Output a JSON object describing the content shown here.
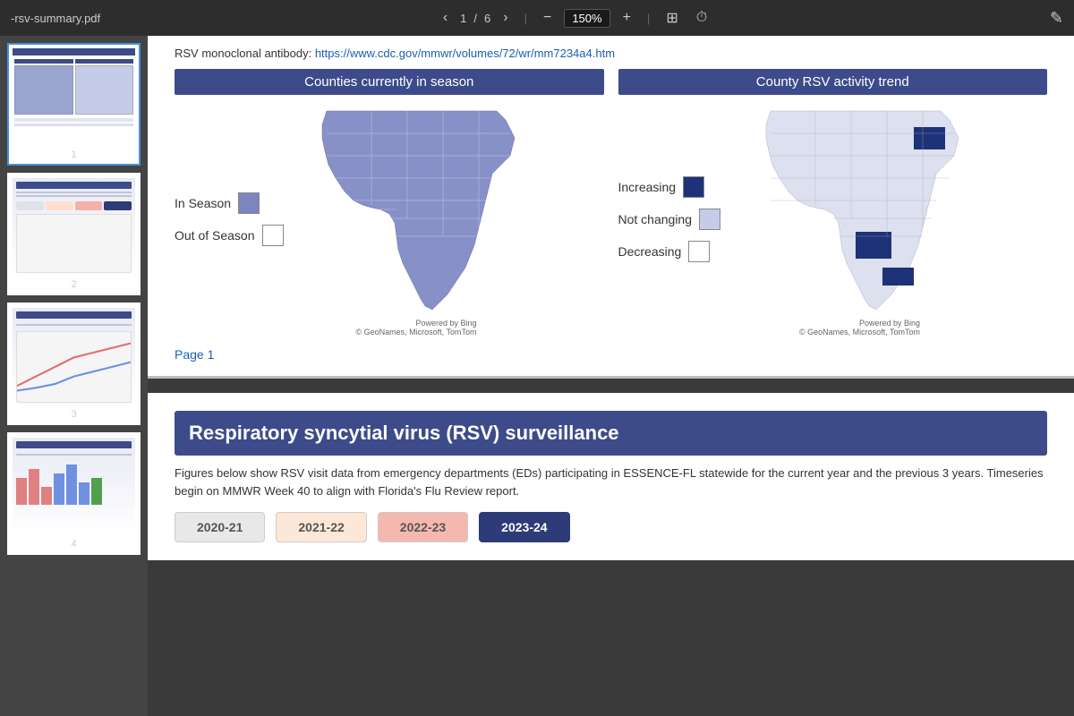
{
  "toolbar": {
    "filename": "-rsv-summary.pdf",
    "page_current": "1",
    "page_total": "6",
    "separator": "/",
    "zoom": "150%",
    "zoom_minus": "−",
    "zoom_plus": "+",
    "edit_icon": "✎"
  },
  "sidebar": {
    "pages": [
      {
        "number": "1",
        "active": true
      },
      {
        "number": "2",
        "active": false
      },
      {
        "number": "3",
        "active": false
      },
      {
        "number": "4",
        "active": false
      }
    ]
  },
  "page1": {
    "rsv_link_text": "RSV monoclonal antibody: ",
    "rsv_link_url": "https://www.cdc.gov/mmwr/volumes/72/wr/mm7234a4.htm",
    "rsv_link_label": "https://www.cdc.gov/mmwr/volumes/72/wr/mm7234a4.htm",
    "map_left_title": "Counties currently in season",
    "map_right_title": "County RSV activity trend",
    "legend_left": [
      {
        "label": "In Season",
        "style": "filled"
      },
      {
        "label": "Out of Season",
        "style": "empty"
      }
    ],
    "legend_right": [
      {
        "label": "Increasing",
        "style": "dark"
      },
      {
        "label": "Not changing",
        "style": "medium"
      },
      {
        "label": "Decreasing",
        "style": "empty"
      }
    ],
    "map_credit": "© GeoNames, Microsoft, TomTom",
    "map_credit2": "Powered by Bing",
    "page_label": "Page 1"
  },
  "page2": {
    "title": "Respiratory syncytial virus (RSV) surveillance",
    "description": "Figures below show RSV visit data from emergency departments (EDs) participating in ESSENCE-FL statewide for the current year and the previous 3 years. Timeseries begin on MMWR Week 40 to align with Florida's Flu Review report.",
    "year_tabs": [
      {
        "label": "2020-21",
        "style": "gray"
      },
      {
        "label": "2021-22",
        "style": "peach"
      },
      {
        "label": "2022-23",
        "style": "salmon"
      },
      {
        "label": "2023-24",
        "style": "dark"
      }
    ]
  }
}
